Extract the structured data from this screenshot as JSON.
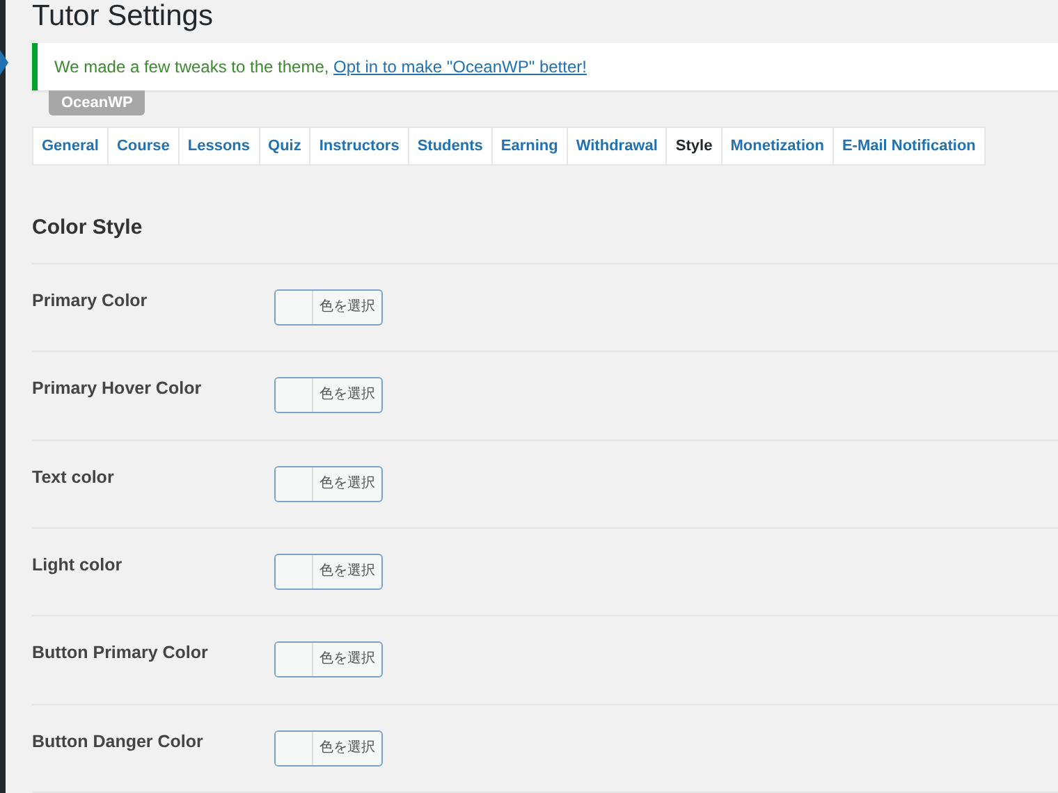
{
  "page_title": "Tutor Settings",
  "notice": {
    "text": "We made a few tweaks to the theme, ",
    "link": "Opt in to make \"OceanWP\" better!"
  },
  "theme_badge": "OceanWP",
  "tabs": [
    {
      "label": "General",
      "selected": false
    },
    {
      "label": "Course",
      "selected": false
    },
    {
      "label": "Lessons",
      "selected": false
    },
    {
      "label": "Quiz",
      "selected": false
    },
    {
      "label": "Instructors",
      "selected": false
    },
    {
      "label": "Students",
      "selected": false
    },
    {
      "label": "Earning",
      "selected": false
    },
    {
      "label": "Withdrawal",
      "selected": false
    },
    {
      "label": "Style",
      "selected": true
    },
    {
      "label": "Monetization",
      "selected": false
    },
    {
      "label": "E-Mail Notification",
      "selected": false
    }
  ],
  "section_title": "Color Style",
  "settings": [
    {
      "label": "Primary Color",
      "button": "色を選択"
    },
    {
      "label": "Primary Hover Color",
      "button": "色を選択"
    },
    {
      "label": "Text color",
      "button": "色を選択"
    },
    {
      "label": "Light color",
      "button": "色を選択"
    },
    {
      "label": "Button Primary Color",
      "button": "色を選択"
    },
    {
      "label": "Button Danger Color",
      "button": "色を選択"
    }
  ]
}
